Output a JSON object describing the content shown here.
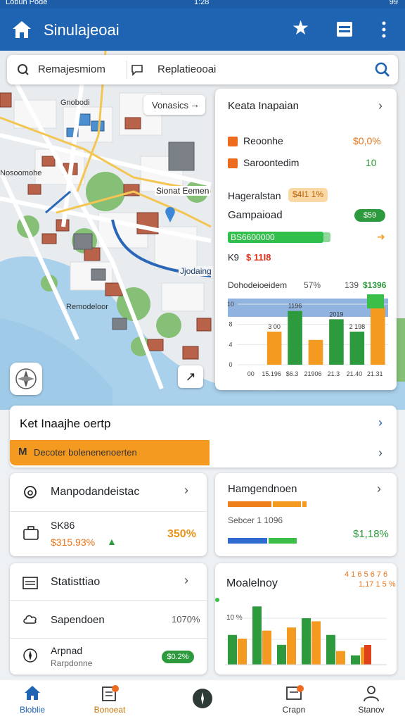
{
  "status_bar": {
    "carrier": "Lobun Pode",
    "time": "1:28",
    "battery": "99"
  },
  "app_bar": {
    "title": "Sinulajeoai"
  },
  "search": {
    "left": "Remajesmiom",
    "right": "Replatieooai"
  },
  "map": {
    "chip": "Vonasics",
    "labels": {
      "north": "Gnobodi",
      "west": "Nosoomohe",
      "center": "Sionat Eemen",
      "road": "Jjodaing",
      "bay": "Remodeloor"
    }
  },
  "side_panel": {
    "title": "Keata Inapaian",
    "row1": {
      "label": "Reoonhe",
      "value": "$0,0%"
    },
    "row2": {
      "label": "Saroontedim",
      "value": "10"
    },
    "row3": {
      "label": "Hageralstan",
      "badge": "$4I1 1%"
    },
    "row4": {
      "label": "Gampaioad",
      "badge": "$59"
    },
    "progress": {
      "label": "BS6600000",
      "value": 0.94
    },
    "row5": {
      "label": "K9",
      "value": "$ 11I8"
    },
    "chart_header": {
      "label": "Dohodeioeidem",
      "v1": "57%",
      "v2": "139",
      "v3": "$1396"
    }
  },
  "chart_data": {
    "type": "bar",
    "categories": [
      "00",
      "15.196",
      "$6.3",
      "21906",
      "21.3",
      "21.40",
      "21.31"
    ],
    "values": [
      0,
      8,
      13,
      6,
      11,
      8,
      14
    ],
    "ylim": [
      0,
      16
    ],
    "yticks": [
      "10",
      "8",
      "4",
      "0"
    ],
    "data_labels": [
      "",
      "3 00",
      "1196",
      "",
      "2019",
      "2 198",
      ""
    ]
  },
  "banner": {
    "title": "Ket Inaajhe oertp",
    "alert_icon": "M",
    "alert_text": "Decoter bolenenenoerten"
  },
  "cards": {
    "c1": {
      "title": "Manpodandeistac",
      "sub1": "SK86",
      "sub2": "$315.93%",
      "value": "350%"
    },
    "c2": {
      "title": "Hamgendnoen",
      "label": "Sebcer 1 1096",
      "value": "$1,18%"
    },
    "c3": {
      "title": "Statisttiao",
      "row2": "Sapendoen",
      "row2v": "1070%",
      "row3": "Arpnad",
      "row3sub": "Rarpdonne",
      "row3badge": "$0.2%"
    },
    "c4": {
      "title": "Moalelnoy",
      "v1": "4 1 6 5 6 7 6",
      "v2": "1,17 1 5 %",
      "tick": "10 %"
    }
  },
  "bars_c4": [
    {
      "g": 0.48,
      "o": 0.42
    },
    {
      "g": 0.94,
      "o": 0.55
    },
    {
      "g": 0.32,
      "o": 0.6
    },
    {
      "g": 0.75,
      "o": 0.7
    },
    {
      "g": 0.48,
      "o": 0.22
    },
    {
      "g": 0.15,
      "o": 0.28
    }
  ],
  "nav": [
    {
      "label": "Bloblie"
    },
    {
      "label": "Bonoeat"
    },
    {
      "label": ""
    },
    {
      "label": "Crapn"
    },
    {
      "label": "Stanov"
    }
  ],
  "colors": {
    "primary": "#1f63b3",
    "orange": "#f49a21",
    "green": "#2e9a3e",
    "blue": "#2f6bd0"
  }
}
